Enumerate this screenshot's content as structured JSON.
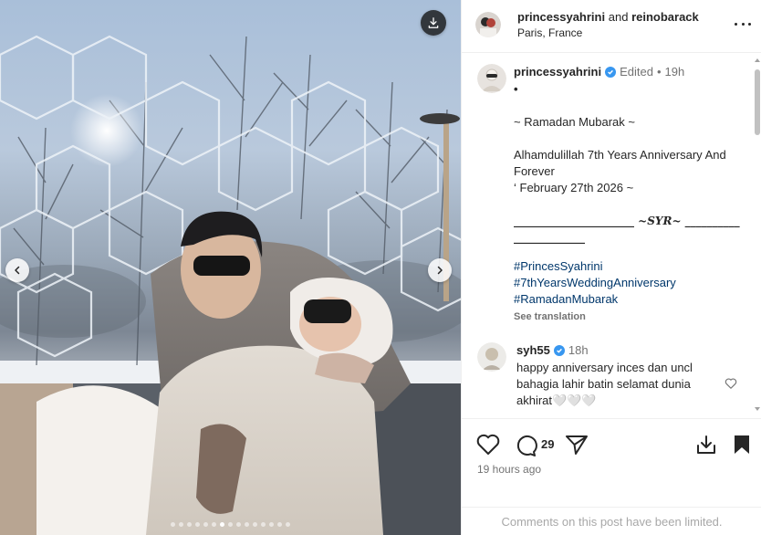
{
  "post": {
    "header": {
      "author": "princessyahrini",
      "connector": "and",
      "coauthor": "reinobarack",
      "location": "Paris, France"
    },
    "caption": {
      "username": "princessyahrini",
      "edited": "Edited",
      "separator": "•",
      "time": "19h",
      "lines": [
        "•",
        "",
        "~ Ramadan Mubarak ~",
        "",
        "Alhamdulillah 7th Years Anniversary And Forever",
        "‘ February 27th 2026 ~",
        "",
        "______________________ ~𝑺𝒀𝑹~ _______________________"
      ],
      "hashtags": [
        "#PrincesSyahrini",
        "#7thYearsWeddingAnniversary",
        "#RamadanMubarak"
      ],
      "see_translation": "See translation"
    },
    "comment": {
      "username": "syh55",
      "time": "18h",
      "text": "happy anniversary inces dan uncl bahagia lahir batin selamat dunia akhirat🤍🤍🤍"
    },
    "actions": {
      "comment_count": "29",
      "timestamp": "19 hours ago",
      "limited_notice": "Comments on this post have been limited."
    },
    "carousel": {
      "total_slides": 15,
      "active_index": 6
    },
    "colors": {
      "verified": "#3897f0",
      "hashtag": "#00376b",
      "muted": "#737373"
    }
  }
}
